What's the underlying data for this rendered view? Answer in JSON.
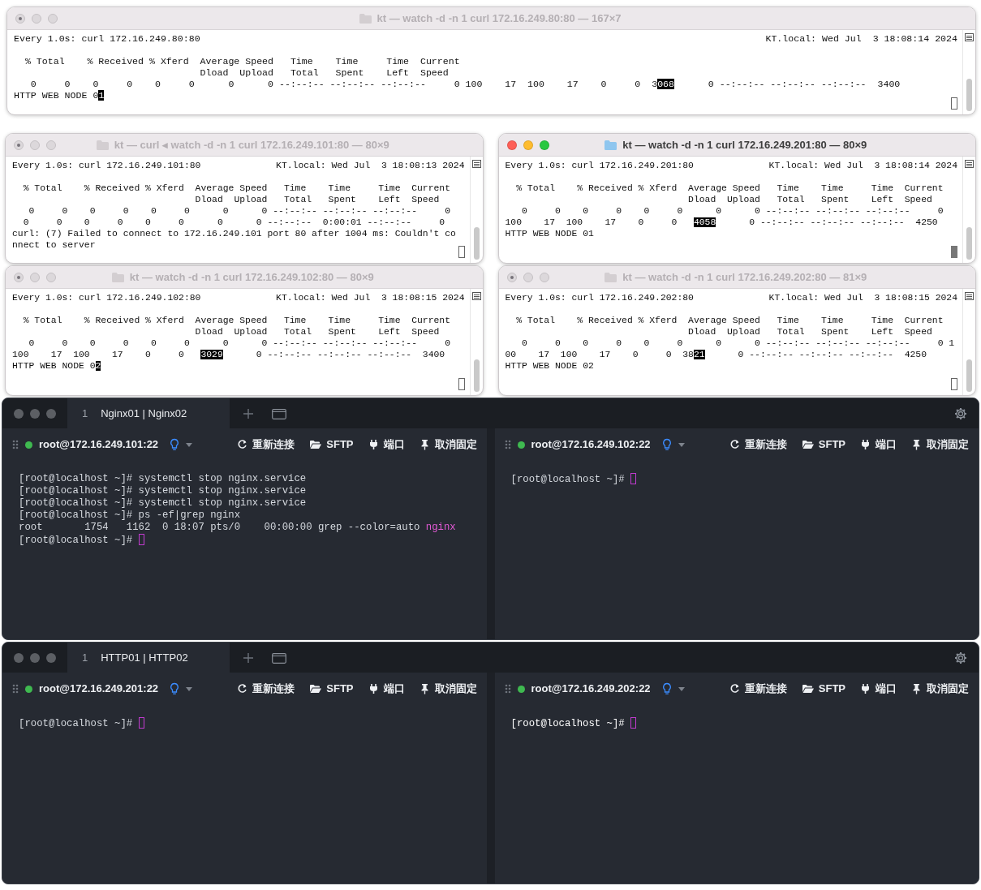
{
  "watch_windows": [
    {
      "title": "kt — watch -d -n 1 curl 172.16.249.80:80 — 167×7",
      "active": false,
      "command": "Every 1.0s: curl 172.16.249.80:80",
      "host_time": "KT.local: Wed Jul  3 18:08:14 2024",
      "lines": [
        [
          {
            "text": "  % Total    % Received % Xferd  Average Speed   Time    Time     Time  Current",
            "inverse": false
          }
        ],
        [
          {
            "text": "                                 Dload  Upload   Total   Spent    Left  Speed",
            "inverse": false
          }
        ],
        [
          {
            "text": "   0     0    0     0    0     0      0      0 --:--:-- --:--:-- --:--:--     0 100    17  100    17    0     0  3",
            "inverse": false
          },
          {
            "text": "068",
            "inverse": true
          },
          {
            "text": "      0 --:--:-- --:--:-- --:--:--  3400",
            "inverse": false
          }
        ],
        [
          {
            "text": "HTTP WEB NODE 0",
            "inverse": false
          },
          {
            "text": "1",
            "inverse": true
          }
        ]
      ]
    },
    {
      "title": "kt — curl ◂ watch -d -n 1 curl 172.16.249.101:80 — 80×9",
      "active": false,
      "command": "Every 1.0s: curl 172.16.249.101:80",
      "host_time": "KT.local: Wed Jul  3 18:08:13 2024",
      "lines": [
        [
          {
            "text": "  % Total    % Received % Xferd  Average Speed   Time    Time     Time  Current",
            "inverse": false
          }
        ],
        [
          {
            "text": "                                 Dload  Upload   Total   Spent    Left  Speed",
            "inverse": false
          }
        ],
        [
          {
            "text": "   0     0    0     0    0     0      0      0 --:--:-- --:--:-- --:--:--     0",
            "inverse": false
          }
        ],
        [
          {
            "text": "  0     0    0     0    0     0      0      0 --:--:--  0:00:01 --:--:--     0",
            "inverse": false
          }
        ],
        [
          {
            "text": "curl: (7) Failed to connect to 172.16.249.101 port 80 after 1004 ms: Couldn't co",
            "inverse": false
          }
        ],
        [
          {
            "text": "nnect to server",
            "inverse": false
          }
        ]
      ]
    },
    {
      "title": "kt — watch -d -n 1 curl 172.16.249.201:80 — 80×9",
      "active": true,
      "command": "Every 1.0s: curl 172.16.249.201:80",
      "host_time": "KT.local: Wed Jul  3 18:08:14 2024",
      "lines": [
        [
          {
            "text": "  % Total    % Received % Xferd  Average Speed   Time    Time     Time  Current",
            "inverse": false
          }
        ],
        [
          {
            "text": "                                 Dload  Upload   Total   Spent    Left  Speed",
            "inverse": false
          }
        ],
        [
          {
            "text": "   0     0    0     0    0     0      0      0 --:--:-- --:--:-- --:--:--     0",
            "inverse": false
          }
        ],
        [
          {
            "text": "100    17  100    17    0     0   ",
            "inverse": false
          },
          {
            "text": "4058",
            "inverse": true
          },
          {
            "text": "      0 --:--:-- --:--:-- --:--:--  4250",
            "inverse": false
          }
        ],
        [
          {
            "text": "HTTP WEB NODE 01",
            "inverse": false
          }
        ]
      ]
    },
    {
      "title": "kt — watch -d -n 1 curl 172.16.249.102:80 — 80×9",
      "active": false,
      "command": "Every 1.0s: curl 172.16.249.102:80",
      "host_time": "KT.local: Wed Jul  3 18:08:15 2024",
      "lines": [
        [
          {
            "text": "  % Total    % Received % Xferd  Average Speed   Time    Time     Time  Current",
            "inverse": false
          }
        ],
        [
          {
            "text": "                                 Dload  Upload   Total   Spent    Left  Speed",
            "inverse": false
          }
        ],
        [
          {
            "text": "   0     0    0     0    0     0      0      0 --:--:-- --:--:-- --:--:--     0",
            "inverse": false
          }
        ],
        [
          {
            "text": "100    17  100    17    0     0   ",
            "inverse": false
          },
          {
            "text": "3029",
            "inverse": true
          },
          {
            "text": "      0 --:--:-- --:--:-- --:--:--  3400",
            "inverse": false
          }
        ],
        [
          {
            "text": "HTTP WEB NODE 0",
            "inverse": false
          },
          {
            "text": "2",
            "inverse": true
          }
        ]
      ]
    },
    {
      "title": "kt — watch -d -n 1 curl 172.16.249.202:80 — 81×9",
      "active": false,
      "command": "Every 1.0s: curl 172.16.249.202:80",
      "host_time": "KT.local: Wed Jul  3 18:08:15 2024",
      "lines": [
        [
          {
            "text": "  % Total    % Received % Xferd  Average Speed   Time    Time     Time  Current",
            "inverse": false
          }
        ],
        [
          {
            "text": "                                 Dload  Upload   Total   Spent    Left  Speed",
            "inverse": false
          }
        ],
        [
          {
            "text": "   0     0    0     0    0     0      0      0 --:--:-- --:--:-- --:--:--     0 1",
            "inverse": false
          }
        ],
        [
          {
            "text": "00    17  100    17    0     0  38",
            "inverse": false
          },
          {
            "text": "21",
            "inverse": true
          },
          {
            "text": "      0 --:--:-- --:--:-- --:--:--  4250",
            "inverse": false
          }
        ],
        [
          {
            "text": "HTTP WEB NODE 02",
            "inverse": false
          }
        ]
      ]
    }
  ],
  "ssh_windows": [
    {
      "tab": {
        "number": "1",
        "label": "Nginx01 | Nginx02",
        "selected": true
      },
      "panes": [
        {
          "host": "root@172.16.249.101:22",
          "connected": true,
          "focused": false,
          "actions": [
            {
              "kind": "reconnect",
              "label": "重新连接"
            },
            {
              "kind": "sftp",
              "label": "SFTP"
            },
            {
              "kind": "port",
              "label": "端口"
            },
            {
              "kind": "unpin",
              "label": "取消固定"
            }
          ],
          "lines": [
            [
              {
                "text": "[root@localhost ~]# systemctl stop nginx.service",
                "match": false
              }
            ],
            [
              {
                "text": "[root@localhost ~]# systemctl stop nginx.service",
                "match": false
              }
            ],
            [
              {
                "text": "[root@localhost ~]# systemctl stop nginx.service",
                "match": false
              }
            ],
            [
              {
                "text": "[root@localhost ~]# ps -ef|grep nginx",
                "match": false
              }
            ],
            [
              {
                "text": "root       1754   1162  0 18:07 pts/0    00:00:00 grep --color=auto ",
                "match": false
              },
              {
                "text": "nginx",
                "match": true
              }
            ],
            [
              {
                "text": "[root@localhost ~]# ",
                "match": false
              }
            ]
          ]
        },
        {
          "host": "root@172.16.249.102:22",
          "connected": true,
          "focused": false,
          "actions": [
            {
              "kind": "reconnect",
              "label": "重新连接"
            },
            {
              "kind": "sftp",
              "label": "SFTP"
            },
            {
              "kind": "port",
              "label": "端口"
            },
            {
              "kind": "unpin",
              "label": "取消固定"
            }
          ],
          "lines": [
            [
              {
                "text": "[root@localhost ~]# ",
                "match": false
              }
            ]
          ]
        }
      ]
    },
    {
      "tab": {
        "number": "1",
        "label": "HTTP01 | HTTP02",
        "selected": true
      },
      "panes": [
        {
          "host": "root@172.16.249.201:22",
          "connected": true,
          "focused": false,
          "actions": [
            {
              "kind": "reconnect",
              "label": "重新连接"
            },
            {
              "kind": "sftp",
              "label": "SFTP"
            },
            {
              "kind": "port",
              "label": "端口"
            },
            {
              "kind": "unpin",
              "label": "取消固定"
            }
          ],
          "lines": [
            [
              {
                "text": "[root@localhost ~]# ",
                "match": false
              }
            ]
          ]
        },
        {
          "host": "root@172.16.249.202:22",
          "connected": true,
          "focused": true,
          "actions": [
            {
              "kind": "reconnect",
              "label": "重新连接"
            },
            {
              "kind": "sftp",
              "label": "SFTP"
            },
            {
              "kind": "port",
              "label": "端口"
            },
            {
              "kind": "unpin",
              "label": "取消固定"
            }
          ],
          "lines": [
            [
              {
                "text": "[root@localhost ~]# ",
                "match": false
              }
            ]
          ]
        }
      ]
    }
  ]
}
